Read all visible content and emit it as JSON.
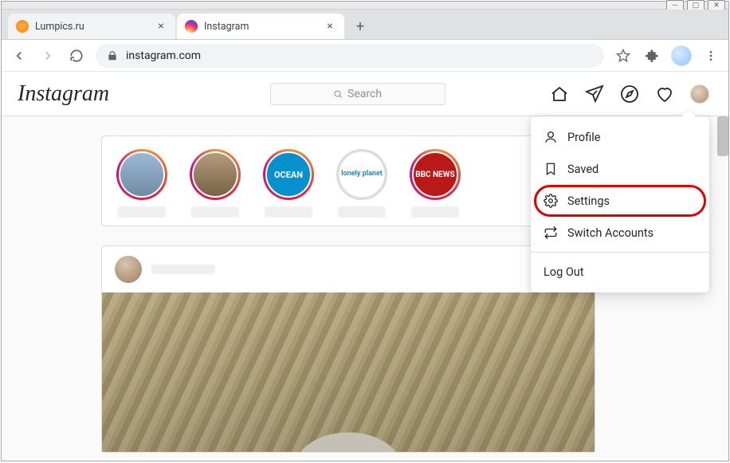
{
  "window": {
    "minimize_tip": "Minimize",
    "maximize_tip": "Maximize",
    "close_tip": "Close"
  },
  "browser": {
    "tabs": [
      {
        "title": "Lumpics.ru",
        "favicon": "lumpics"
      },
      {
        "title": "Instagram",
        "favicon": "instagram"
      }
    ],
    "active_tab": 1,
    "url": "instagram.com"
  },
  "nav": {
    "logo": "Instagram",
    "search_placeholder": "Search"
  },
  "stories": [
    {
      "badge": "",
      "style": "s1"
    },
    {
      "badge": "",
      "style": "s2"
    },
    {
      "badge": "OCEAN",
      "style": "s3"
    },
    {
      "badge": "lonely planet",
      "style": "s4"
    },
    {
      "badge": "BBC NEWS",
      "style": "s5"
    }
  ],
  "dropdown": {
    "profile": "Profile",
    "saved": "Saved",
    "settings": "Settings",
    "switch": "Switch Accounts",
    "logout": "Log Out"
  }
}
